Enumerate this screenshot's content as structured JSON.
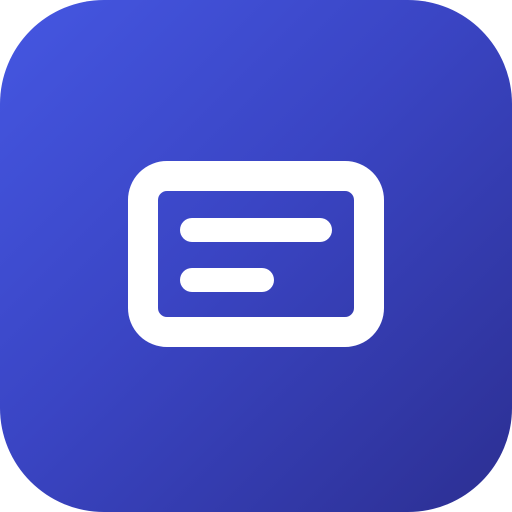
{
  "icon": {
    "name": "message-card-icon",
    "colors": {
      "gradient_start": "#4557e2",
      "gradient_mid": "#3a45c4",
      "gradient_end": "#2c2f92",
      "glyph": "#ffffff"
    }
  }
}
